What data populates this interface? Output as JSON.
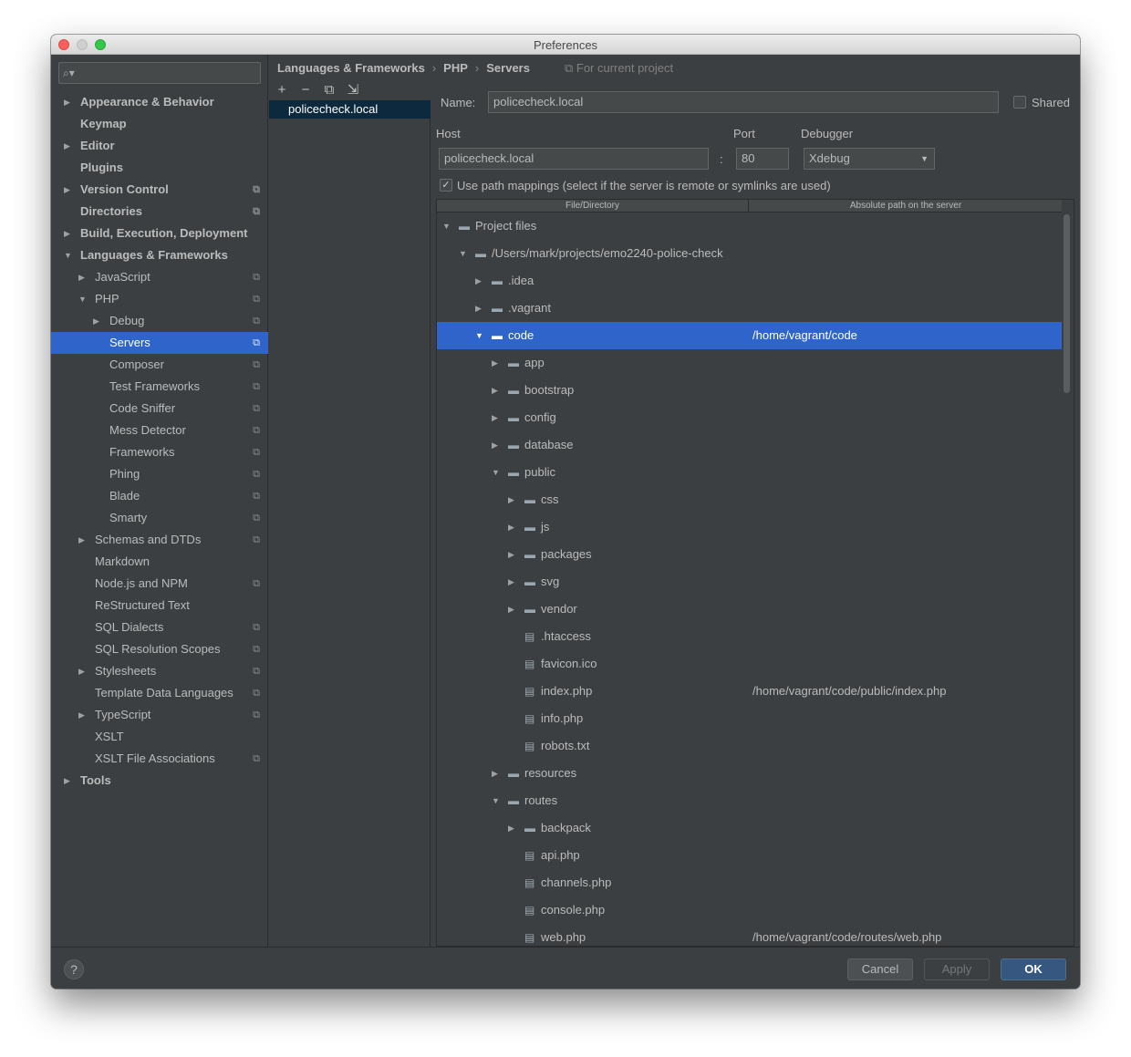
{
  "window": {
    "title": "Preferences"
  },
  "sidebar": {
    "search_placeholder": "",
    "items": [
      {
        "label": "Appearance & Behavior",
        "level": 0,
        "arrow": "right",
        "bold": true,
        "proj": false
      },
      {
        "label": "Keymap",
        "level": 0,
        "arrow": "",
        "bold": true,
        "proj": false
      },
      {
        "label": "Editor",
        "level": 0,
        "arrow": "right",
        "bold": true,
        "proj": false
      },
      {
        "label": "Plugins",
        "level": 0,
        "arrow": "",
        "bold": true,
        "proj": false
      },
      {
        "label": "Version Control",
        "level": 0,
        "arrow": "right",
        "bold": true,
        "proj": true
      },
      {
        "label": "Directories",
        "level": 0,
        "arrow": "",
        "bold": true,
        "proj": true
      },
      {
        "label": "Build, Execution, Deployment",
        "level": 0,
        "arrow": "right",
        "bold": true,
        "proj": false
      },
      {
        "label": "Languages & Frameworks",
        "level": 0,
        "arrow": "down",
        "bold": true,
        "proj": false
      },
      {
        "label": "JavaScript",
        "level": 1,
        "arrow": "right",
        "bold": false,
        "proj": true
      },
      {
        "label": "PHP",
        "level": 1,
        "arrow": "down",
        "bold": false,
        "proj": true
      },
      {
        "label": "Debug",
        "level": 2,
        "arrow": "right",
        "bold": false,
        "proj": true
      },
      {
        "label": "Servers",
        "level": 2,
        "arrow": "",
        "bold": false,
        "proj": true,
        "selected": true
      },
      {
        "label": "Composer",
        "level": 2,
        "arrow": "",
        "bold": false,
        "proj": true
      },
      {
        "label": "Test Frameworks",
        "level": 2,
        "arrow": "",
        "bold": false,
        "proj": true
      },
      {
        "label": "Code Sniffer",
        "level": 2,
        "arrow": "",
        "bold": false,
        "proj": true
      },
      {
        "label": "Mess Detector",
        "level": 2,
        "arrow": "",
        "bold": false,
        "proj": true
      },
      {
        "label": "Frameworks",
        "level": 2,
        "arrow": "",
        "bold": false,
        "proj": true
      },
      {
        "label": "Phing",
        "level": 2,
        "arrow": "",
        "bold": false,
        "proj": true
      },
      {
        "label": "Blade",
        "level": 2,
        "arrow": "",
        "bold": false,
        "proj": true
      },
      {
        "label": "Smarty",
        "level": 2,
        "arrow": "",
        "bold": false,
        "proj": true
      },
      {
        "label": "Schemas and DTDs",
        "level": 1,
        "arrow": "right",
        "bold": false,
        "proj": true
      },
      {
        "label": "Markdown",
        "level": 1,
        "arrow": "",
        "bold": false,
        "proj": false
      },
      {
        "label": "Node.js and NPM",
        "level": 1,
        "arrow": "",
        "bold": false,
        "proj": true
      },
      {
        "label": "ReStructured Text",
        "level": 1,
        "arrow": "",
        "bold": false,
        "proj": false
      },
      {
        "label": "SQL Dialects",
        "level": 1,
        "arrow": "",
        "bold": false,
        "proj": true
      },
      {
        "label": "SQL Resolution Scopes",
        "level": 1,
        "arrow": "",
        "bold": false,
        "proj": true
      },
      {
        "label": "Stylesheets",
        "level": 1,
        "arrow": "right",
        "bold": false,
        "proj": true
      },
      {
        "label": "Template Data Languages",
        "level": 1,
        "arrow": "",
        "bold": false,
        "proj": true
      },
      {
        "label": "TypeScript",
        "level": 1,
        "arrow": "right",
        "bold": false,
        "proj": true
      },
      {
        "label": "XSLT",
        "level": 1,
        "arrow": "",
        "bold": false,
        "proj": false
      },
      {
        "label": "XSLT File Associations",
        "level": 1,
        "arrow": "",
        "bold": false,
        "proj": true
      },
      {
        "label": "Tools",
        "level": 0,
        "arrow": "right",
        "bold": true,
        "proj": false
      }
    ]
  },
  "header": {
    "crumbs": [
      "Languages & Frameworks",
      "PHP",
      "Servers"
    ],
    "separator": "›",
    "scope": "For current project"
  },
  "toolbar": {
    "add": "+",
    "remove": "−",
    "copy": "⧉",
    "import": "⇲"
  },
  "servers": [
    "policecheck.local"
  ],
  "form": {
    "name_label": "Name:",
    "name_value": "policecheck.local",
    "shared_label": "Shared",
    "shared_checked": false,
    "host_label": "Host",
    "host_value": "policecheck.local",
    "colon": ":",
    "port_label": "Port",
    "port_value": "80",
    "debugger_label": "Debugger",
    "debugger_value": "Xdebug",
    "path_mappings_label": "Use path mappings (select if the server is remote or symlinks are used)",
    "path_mappings_checked": true
  },
  "mappings": {
    "columns": [
      "File/Directory",
      "Absolute path on the server"
    ],
    "rows": [
      {
        "name": "Project files",
        "depth": 0,
        "arrow": "down",
        "type": "folder",
        "server": ""
      },
      {
        "name": "/Users/mark/projects/emo2240-police-check",
        "depth": 1,
        "arrow": "down",
        "type": "folder",
        "server": ""
      },
      {
        "name": ".idea",
        "depth": 2,
        "arrow": "right",
        "type": "folder",
        "server": ""
      },
      {
        "name": ".vagrant",
        "depth": 2,
        "arrow": "right",
        "type": "folder",
        "server": ""
      },
      {
        "name": "code",
        "depth": 2,
        "arrow": "down",
        "type": "folder",
        "server": "/home/vagrant/code",
        "selected": true
      },
      {
        "name": "app",
        "depth": 3,
        "arrow": "right",
        "type": "folder",
        "server": ""
      },
      {
        "name": "bootstrap",
        "depth": 3,
        "arrow": "right",
        "type": "folder",
        "server": ""
      },
      {
        "name": "config",
        "depth": 3,
        "arrow": "right",
        "type": "folder",
        "server": ""
      },
      {
        "name": "database",
        "depth": 3,
        "arrow": "right",
        "type": "folder",
        "server": ""
      },
      {
        "name": "public",
        "depth": 3,
        "arrow": "down",
        "type": "folder",
        "server": ""
      },
      {
        "name": "css",
        "depth": 4,
        "arrow": "right",
        "type": "folder",
        "server": ""
      },
      {
        "name": "js",
        "depth": 4,
        "arrow": "right",
        "type": "folder",
        "server": ""
      },
      {
        "name": "packages",
        "depth": 4,
        "arrow": "right",
        "type": "folder",
        "server": ""
      },
      {
        "name": "svg",
        "depth": 4,
        "arrow": "right",
        "type": "folder",
        "server": ""
      },
      {
        "name": "vendor",
        "depth": 4,
        "arrow": "right",
        "type": "folder",
        "server": ""
      },
      {
        "name": ".htaccess",
        "depth": 4,
        "arrow": "",
        "type": "file",
        "server": ""
      },
      {
        "name": "favicon.ico",
        "depth": 4,
        "arrow": "",
        "type": "file",
        "server": ""
      },
      {
        "name": "index.php",
        "depth": 4,
        "arrow": "",
        "type": "php",
        "server": "/home/vagrant/code/public/index.php"
      },
      {
        "name": "info.php",
        "depth": 4,
        "arrow": "",
        "type": "php",
        "server": ""
      },
      {
        "name": "robots.txt",
        "depth": 4,
        "arrow": "",
        "type": "file",
        "server": ""
      },
      {
        "name": "resources",
        "depth": 3,
        "arrow": "right",
        "type": "folder",
        "server": ""
      },
      {
        "name": "routes",
        "depth": 3,
        "arrow": "down",
        "type": "folder",
        "server": ""
      },
      {
        "name": "backpack",
        "depth": 4,
        "arrow": "right",
        "type": "folder",
        "server": ""
      },
      {
        "name": "api.php",
        "depth": 4,
        "arrow": "",
        "type": "php",
        "server": ""
      },
      {
        "name": "channels.php",
        "depth": 4,
        "arrow": "",
        "type": "php",
        "server": ""
      },
      {
        "name": "console.php",
        "depth": 4,
        "arrow": "",
        "type": "php",
        "server": ""
      },
      {
        "name": "web.php",
        "depth": 4,
        "arrow": "",
        "type": "php",
        "server": "/home/vagrant/code/routes/web.php"
      }
    ]
  },
  "footer": {
    "help": "?",
    "cancel": "Cancel",
    "apply": "Apply",
    "ok": "OK"
  },
  "colors": {
    "background": "#3c3f41",
    "selection": "#2f65ca",
    "ok_button": "#365880"
  }
}
